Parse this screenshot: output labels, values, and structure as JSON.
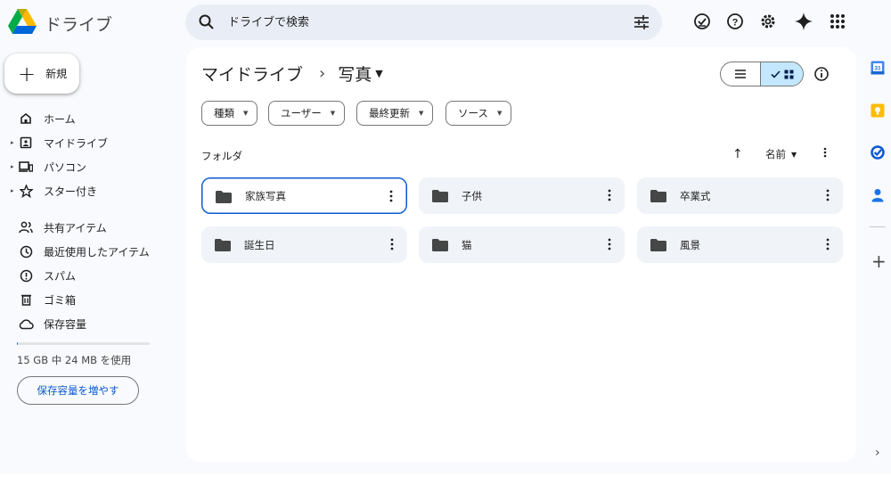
{
  "app": {
    "name": "ドライブ",
    "brand_colors": [
      "#0066da",
      "#00ac47",
      "#ffba00",
      "#ea4335"
    ]
  },
  "search": {
    "placeholder": "ドライブで検索"
  },
  "header_icons": [
    "ready-for-offline-icon",
    "help-icon",
    "settings-icon",
    "gemini-icon",
    "apps-grid-icon"
  ],
  "new_button": {
    "label": "新規"
  },
  "nav": {
    "items": [
      {
        "label": "ホーム",
        "icon": "home-icon"
      },
      {
        "label": "マイドライブ",
        "icon": "my-drive-icon",
        "expandable": true
      },
      {
        "label": "パソコン",
        "icon": "computers-icon",
        "expandable": true
      },
      {
        "label": "スター付き",
        "icon": "star-icon",
        "expandable": true
      },
      {
        "label": "共有アイテム",
        "icon": "shared-icon"
      },
      {
        "label": "最近使用したアイテム",
        "icon": "recent-icon"
      },
      {
        "label": "スパム",
        "icon": "spam-icon"
      },
      {
        "label": "ゴミ箱",
        "icon": "trash-icon"
      },
      {
        "label": "保存容量",
        "icon": "cloud-icon"
      }
    ]
  },
  "storage": {
    "used_text": "15 GB 中 24 MB を使用",
    "used_fraction": 0.0016,
    "upgrade_label": "保存容量を増やす"
  },
  "breadcrumb": {
    "root": "マイドライブ",
    "current": "写真"
  },
  "view": {
    "mode": "grid"
  },
  "filters": [
    "種類",
    "ユーザー",
    "最終更新",
    "ソース"
  ],
  "folders_section": {
    "title": "フォルダ",
    "sort_label": "名前"
  },
  "folders": [
    {
      "name": "家族写真",
      "selected": true
    },
    {
      "name": "子供"
    },
    {
      "name": "卒業式"
    },
    {
      "name": "誕生日"
    },
    {
      "name": "猫"
    },
    {
      "name": "風景"
    }
  ],
  "right_rail": [
    "calendar-icon",
    "keep-icon",
    "tasks-icon",
    "contacts-icon"
  ],
  "calendar_day": "31",
  "colors": {
    "accent": "#0b57d0",
    "selected_view": "#c2e7ff",
    "folder_bg": "#f0f4f9"
  }
}
